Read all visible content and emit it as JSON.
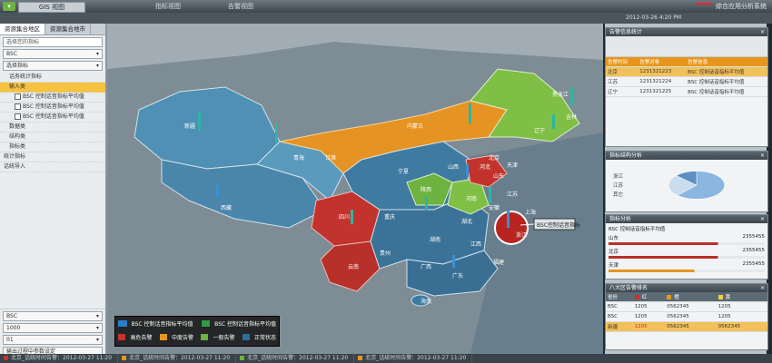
{
  "topbar": {
    "brand": "GIS 视图",
    "tabs": [
      "指标视图",
      "告警视图"
    ],
    "logo": "综合应用分析系统",
    "datetime": "2012-03-26 4:20 PM"
  },
  "left": {
    "tabs": [
      "资源集合地区",
      "资源集合地市"
    ],
    "search_placeholder": "选择您的指标",
    "selects": [
      "BSC",
      "选择指标"
    ],
    "tree": [
      {
        "label": "话务统计指标",
        "level": "grp",
        "hl": false
      },
      {
        "label": "输入类",
        "level": "grp",
        "hl": true
      },
      {
        "label": "BSC 控制话音指标平均值",
        "level": "leaf",
        "hl": false
      },
      {
        "label": "BSC 控制话音指标平均值",
        "level": "leaf",
        "hl": false
      },
      {
        "label": "BSC 控制话音指标平均值",
        "level": "leaf",
        "hl": false
      },
      {
        "label": "数据类",
        "level": "grp",
        "hl": false
      },
      {
        "label": "结构类",
        "level": "grp",
        "hl": false
      },
      {
        "label": "指标类",
        "level": "grp",
        "hl": false
      },
      {
        "label": "统计指标",
        "level": "item",
        "hl": false
      },
      {
        "label": "话统导入",
        "level": "item",
        "hl": false
      }
    ],
    "bottom": [
      "BSC",
      "1000",
      "01",
      "输出过程中参数设定"
    ]
  },
  "map": {
    "provinces": [
      "新疆",
      "西藏",
      "青海",
      "甘肃",
      "内蒙古",
      "黑龙江",
      "吉林",
      "辽宁",
      "北京",
      "天津",
      "河北",
      "山西",
      "陕西",
      "宁夏",
      "四川",
      "重庆",
      "云南",
      "贵州",
      "广西",
      "广东",
      "湖南",
      "湖北",
      "河南",
      "山东",
      "江苏",
      "安徽",
      "浙江",
      "江西",
      "福建",
      "上海",
      "海南"
    ],
    "highlight": {
      "name": "浙江",
      "label": "BSC控制话音指标"
    },
    "legend": {
      "series": [
        {
          "color": "#2b7fc9",
          "label": "BSC 控制话音指标平均值"
        },
        {
          "color": "#2f9b43",
          "label": "BSC 控制话音指标平均值"
        }
      ],
      "levels": [
        {
          "color": "#c8322c",
          "label": "高危告警"
        },
        {
          "color": "#e7961d",
          "label": "中度告警"
        },
        {
          "color": "#6db33f",
          "label": "一般告警"
        },
        {
          "color": "#2a6f9b",
          "label": "正常状态"
        }
      ]
    }
  },
  "right": {
    "p1": {
      "title": "告警信息统计",
      "header": [
        "告警时间",
        "告警对象",
        "告警信息"
      ],
      "rows": [
        [
          "北京",
          "1231321223",
          "BSC 控制话音指标平均值"
        ],
        [
          "江苏",
          "1231321224",
          "BSC 控制话音指标平均值"
        ],
        [
          "辽宁",
          "1231321225",
          "BSC 控制话音指标平均值"
        ]
      ]
    },
    "p2": {
      "title": "指标结构分析",
      "pie": [
        {
          "label": "浙江",
          "value": 62,
          "color": "#8ab6e0"
        },
        {
          "label": "江苏",
          "value": 25,
          "color": "#c9ddef"
        },
        {
          "label": "其它",
          "value": 13,
          "color": "#5d8fc2"
        }
      ]
    },
    "p3": {
      "title": "指标分析",
      "name": "BSC 控制话音指标平均值",
      "rows": [
        {
          "name": "山东",
          "value": "2355455"
        },
        {
          "name": "北京",
          "value": "2355455"
        },
        {
          "name": "天津",
          "value": "2355455"
        }
      ]
    },
    "p4": {
      "title": "八大区告警排名",
      "cols": [
        "省份",
        "红",
        "橙",
        "黄"
      ],
      "rows": [
        [
          "BSC",
          "1205",
          "0562345",
          "1205"
        ],
        [
          "BSC",
          "1205",
          "0562345",
          "1205"
        ],
        [
          "新疆",
          "1205",
          "0562345",
          "0562345"
        ]
      ]
    }
  },
  "status": [
    {
      "color": "#c8322c",
      "text": "北京_话统时间告警：2012-03-27 11:20"
    },
    {
      "color": "#e7961d",
      "text": "北京_话统时间告警：2012-03-27 11:20"
    },
    {
      "color": "#6db33f",
      "text": "北京_话统时间告警：2012-03-27 11:20"
    },
    {
      "color": "#e7961d",
      "text": "北京_话统时间告警：2012-03-27 11:20"
    }
  ]
}
